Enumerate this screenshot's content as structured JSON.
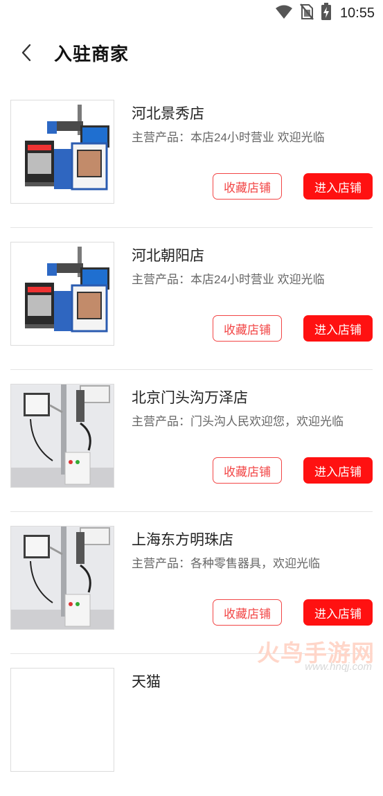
{
  "status_bar": {
    "time": "10:55"
  },
  "header": {
    "title": "入驻商家"
  },
  "stores": [
    {
      "name": "河北景秀店",
      "desc": "主营产品：本店24小时营业 欢迎光临",
      "fav_label": "收藏店铺",
      "enter_label": "进入店铺",
      "image": "desktop-laser-marker"
    },
    {
      "name": "河北朝阳店",
      "desc": "主营产品：本店24小时营业 欢迎光临",
      "fav_label": "收藏店铺",
      "enter_label": "进入店铺",
      "image": "desktop-laser-marker"
    },
    {
      "name": "北京门头沟万泽店",
      "desc": "主营产品：门头沟人民欢迎您，欢迎光临",
      "fav_label": "收藏店铺",
      "enter_label": "进入店铺",
      "image": "stand-laser-marker"
    },
    {
      "name": "上海东方明珠店",
      "desc": "主营产品：各种零售器具，欢迎光临",
      "fav_label": "收藏店铺",
      "enter_label": "进入店铺",
      "image": "stand-laser-marker"
    },
    {
      "name": "天猫",
      "desc": "",
      "fav_label": "",
      "enter_label": "",
      "image": ""
    }
  ],
  "watermark": {
    "text": "火鸟手游网",
    "url": "www.hnqj.com"
  },
  "colors": {
    "accent": "#ff1111",
    "fav_border": "#f24545"
  }
}
